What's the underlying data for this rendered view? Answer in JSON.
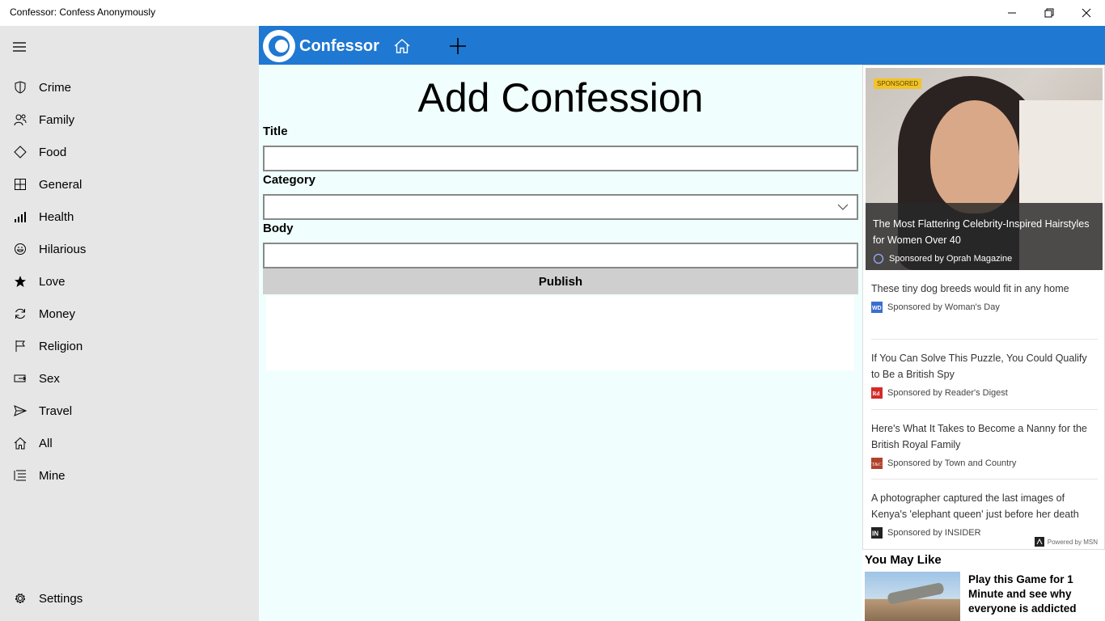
{
  "window": {
    "title": "Confessor: Confess Anonymously"
  },
  "sidebar": {
    "items": [
      {
        "label": "Crime",
        "icon": "shield-icon"
      },
      {
        "label": "Family",
        "icon": "people-icon"
      },
      {
        "label": "Food",
        "icon": "diamond-icon"
      },
      {
        "label": "General",
        "icon": "grid-icon"
      },
      {
        "label": "Health",
        "icon": "signal-bars-icon"
      },
      {
        "label": "Hilarious",
        "icon": "smiley-icon"
      },
      {
        "label": "Love",
        "icon": "star-icon"
      },
      {
        "label": "Money",
        "icon": "refresh-icon"
      },
      {
        "label": "Religion",
        "icon": "flag-icon"
      },
      {
        "label": "Sex",
        "icon": "remote-icon"
      },
      {
        "label": "Travel",
        "icon": "send-icon"
      },
      {
        "label": "All",
        "icon": "home-icon"
      },
      {
        "label": "Mine",
        "icon": "list-icon"
      }
    ],
    "settings_label": "Settings"
  },
  "appbar": {
    "brand": "Confessor",
    "accent_color": "#1f78d1"
  },
  "form": {
    "heading": "Add Confession",
    "title_label": "Title",
    "title_value": "",
    "category_label": "Category",
    "category_value": "",
    "body_label": "Body",
    "body_value": "",
    "publish_label": "Publish"
  },
  "ads": {
    "sponsored_tag": "SPONSORED",
    "hero": {
      "title": "The Most Flattering Celebrity-Inspired Hairstyles for Women Over 40",
      "source": "Sponsored by Oprah Magazine"
    },
    "items": [
      {
        "title": "These tiny dog breeds would fit in any home",
        "source": "Sponsored by Woman's Day"
      },
      {
        "title": "If You Can Solve This Puzzle, You Could Qualify to Be a British Spy",
        "source": "Sponsored by Reader's Digest"
      },
      {
        "title": "Here's What It Takes to Become a Nanny for the British Royal Family",
        "source": "Sponsored by Town and Country"
      },
      {
        "title": "A photographer captured the last images of Kenya's 'elephant queen' just before her death",
        "source": "Sponsored by INSIDER"
      }
    ],
    "powered_by": "Powered by MSN"
  },
  "you_may_like": {
    "heading": "You May Like",
    "item_text": "Play this Game for 1 Minute and see why everyone is addicted"
  }
}
